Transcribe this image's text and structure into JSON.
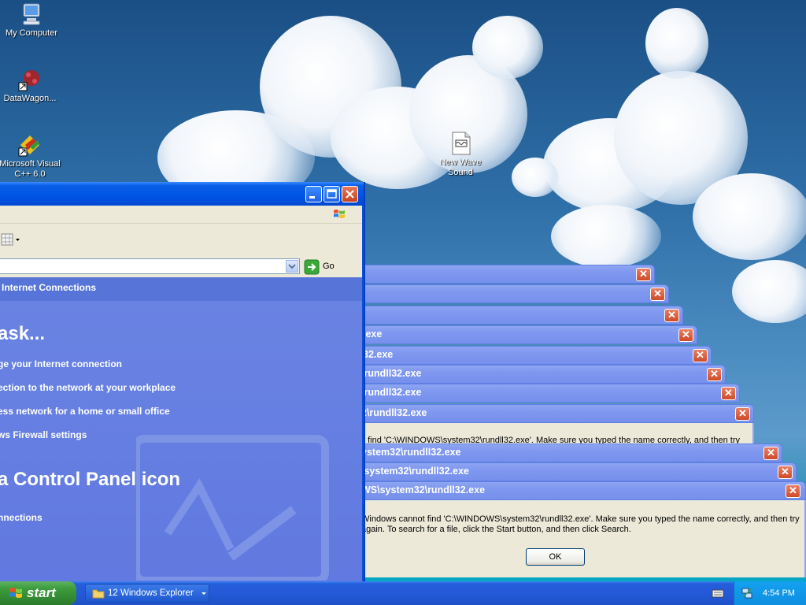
{
  "desktop": {
    "icons": [
      {
        "label": "My Computer"
      },
      {
        "label": "DataWagon..."
      },
      {
        "label": "Microsoft Visual C++ 6.0"
      },
      {
        "label": "New Wave Sound"
      }
    ]
  },
  "explorer": {
    "address_go_label": "Go",
    "header_text": "Internet Connections",
    "pick_task_heading": "ask...",
    "tasks": [
      "ge your Internet connection",
      "ection to the network at your workplace",
      "ess network for a home or small office",
      "ws Firewall settings"
    ],
    "control_panel_heading": "a Control Panel icon",
    "cp_items": [
      "nnections"
    ]
  },
  "dialogs": {
    "titles": [
      "",
      "",
      "e",
      ".exe",
      "32.exe",
      "\\rundll32.exe",
      "\\rundll32.exe",
      "2\\rundll32.exe",
      "ystem32\\rundll32.exe",
      "\\system32\\rundll32.exe",
      "WS\\system32\\rundll32.exe"
    ],
    "partial_message": "t find 'C:\\WINDOWS\\system32\\rundll32.exe'. Make sure you typed the name correctly, and then try",
    "message_line1": "Windows cannot find 'C:\\WINDOWS\\system32\\rundll32.exe'. Make sure you typed the name correctly, and then try",
    "message_line2": "again. To search for a file, click the Start button, and then click Search.",
    "ok_label": "OK",
    "close_glyph": "✕"
  },
  "taskbar": {
    "start_label": "start",
    "task_button_label": "12 Windows Explorer",
    "clock": "4:54 PM"
  },
  "colors": {
    "title_blue": "#0055e5",
    "dialog_title": "#7f97ef",
    "taskpane_bg": "#6a84e3",
    "start_green": "#3c9c3c"
  }
}
